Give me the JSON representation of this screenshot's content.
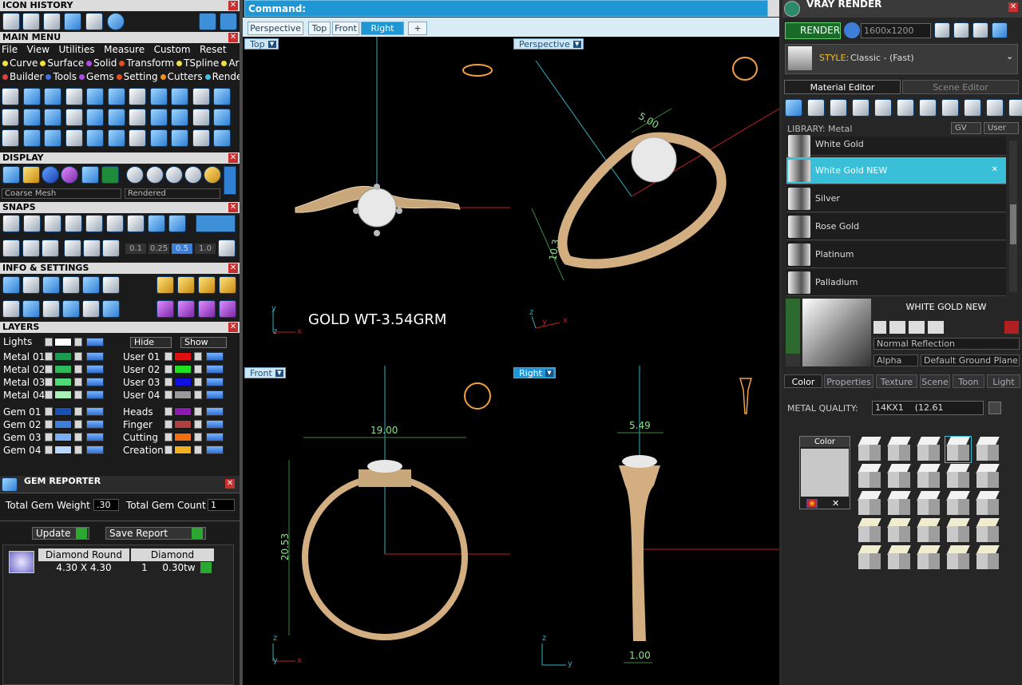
{
  "icon_history": {
    "title": "ICON HISTORY"
  },
  "main_menu": {
    "title": "MAIN MENU",
    "row1": [
      "File",
      "View",
      "Utilities",
      "Measure",
      "Custom",
      "Reset"
    ],
    "row2": [
      {
        "label": "Curve",
        "color": "#f0e040"
      },
      {
        "label": "Surface",
        "color": "#f0e040"
      },
      {
        "label": "Solid",
        "color": "#b04ce0"
      },
      {
        "label": "Transform",
        "color": "#e05020"
      },
      {
        "label": "TSpline",
        "color": "#f0e040"
      },
      {
        "label": "Art",
        "color": "#f0e040"
      }
    ],
    "row3": [
      {
        "label": "Builder",
        "color": "#e04040"
      },
      {
        "label": "Tools",
        "color": "#4070e0"
      },
      {
        "label": "Gems",
        "color": "#b04ce0"
      },
      {
        "label": "Setting",
        "color": "#e05020"
      },
      {
        "label": "Cutters",
        "color": "#f09020"
      },
      {
        "label": "Render",
        "color": "#40c0e0"
      }
    ]
  },
  "display": {
    "title": "DISPLAY",
    "mesh": "Coarse Mesh",
    "mode": "Rendered"
  },
  "snaps": {
    "title": "SNAPS",
    "values": [
      "0.1",
      "0.25",
      "0.5",
      "1.0"
    ]
  },
  "info": {
    "title": "INFO & SETTINGS"
  },
  "layers": {
    "title": "LAYERS",
    "lights": "Lights",
    "hide": "Hide",
    "show": "Show",
    "left_col": [
      {
        "name": "Metal 01",
        "color": "#1e9a50"
      },
      {
        "name": "Metal 02",
        "color": "#2dbb5e"
      },
      {
        "name": "Metal 03",
        "color": "#52d67a"
      },
      {
        "name": "Metal 04",
        "color": "#a8f0b8"
      },
      {
        "name": "Gem 01",
        "color": "#1a4fb5"
      },
      {
        "name": "Gem 02",
        "color": "#3d7fd8"
      },
      {
        "name": "Gem 03",
        "color": "#7aaef0"
      },
      {
        "name": "Gem 04",
        "color": "#b8d6fa"
      }
    ],
    "right_col": [
      {
        "name": "User 01",
        "color": "#e01010"
      },
      {
        "name": "User 02",
        "color": "#20e020"
      },
      {
        "name": "User 03",
        "color": "#1010e0"
      },
      {
        "name": "User 04",
        "color": "#9a9a9a"
      },
      {
        "name": "Heads",
        "color": "#8a1ab0"
      },
      {
        "name": "Finger",
        "color": "#b04040"
      },
      {
        "name": "Cutting",
        "color": "#f07010"
      },
      {
        "name": "Creation",
        "color": "#f0b020"
      }
    ]
  },
  "gem_reporter": {
    "title": "GEM REPORTER",
    "weight_label": "Total Gem Weight",
    "weight_value": ".30",
    "count_label": "Total Gem Count",
    "count_value": "1",
    "update": "Update",
    "save": "Save Report",
    "headers": [
      "Diamond Round",
      "Diamond"
    ],
    "row": {
      "size": "4.30 X 4.30",
      "qty": "1",
      "weight": "0.30tw"
    }
  },
  "command": {
    "label": "Command:"
  },
  "view_tabs": [
    "Perspective",
    "Top",
    "Front",
    "Right",
    "+"
  ],
  "active_tab": "Right",
  "viewports": {
    "top": {
      "label": "Top",
      "note": "GOLD WT-3.54GRM",
      "axes": [
        "y",
        "z",
        "x"
      ]
    },
    "perspective": {
      "label": "Perspective",
      "dims": [
        "5.00",
        "10.3"
      ],
      "axes": [
        "z",
        "y",
        "x"
      ]
    },
    "front": {
      "label": "Front",
      "width": "19.00",
      "height": "20.53",
      "axes": [
        "z",
        "y",
        "x"
      ]
    },
    "right": {
      "label": "Right",
      "top_width": "5.49",
      "bottom_width": "1.00",
      "axes": [
        "z",
        "y"
      ]
    }
  },
  "vray": {
    "title": "VRAY RENDER",
    "render": "RENDER",
    "resolution": "1600x1200",
    "style_label": "STYLE:",
    "style_value": "Classic - (Fast)",
    "tabs": [
      "Material Editor",
      "Scene Editor"
    ],
    "library": "LIBRARY: Metal",
    "gv": "GV",
    "user": "User",
    "materials": [
      "White Gold",
      "White Gold NEW",
      "Silver",
      "Rose Gold",
      "Platinum",
      "Palladium"
    ],
    "selected_material": "White Gold NEW",
    "preview_title": "WHITE GOLD NEW",
    "reflection": "Normal Reflection",
    "alpha": "Alpha",
    "ground": "Default Ground Plane",
    "prop_tabs": [
      "Color",
      "Properties",
      "Texture",
      "Scene",
      "Toon",
      "Light"
    ],
    "metal_quality_label": "METAL QUALITY:",
    "metal_quality_value": "14KX1",
    "metal_quality_extra": "(12.61",
    "color_label": "Color"
  }
}
